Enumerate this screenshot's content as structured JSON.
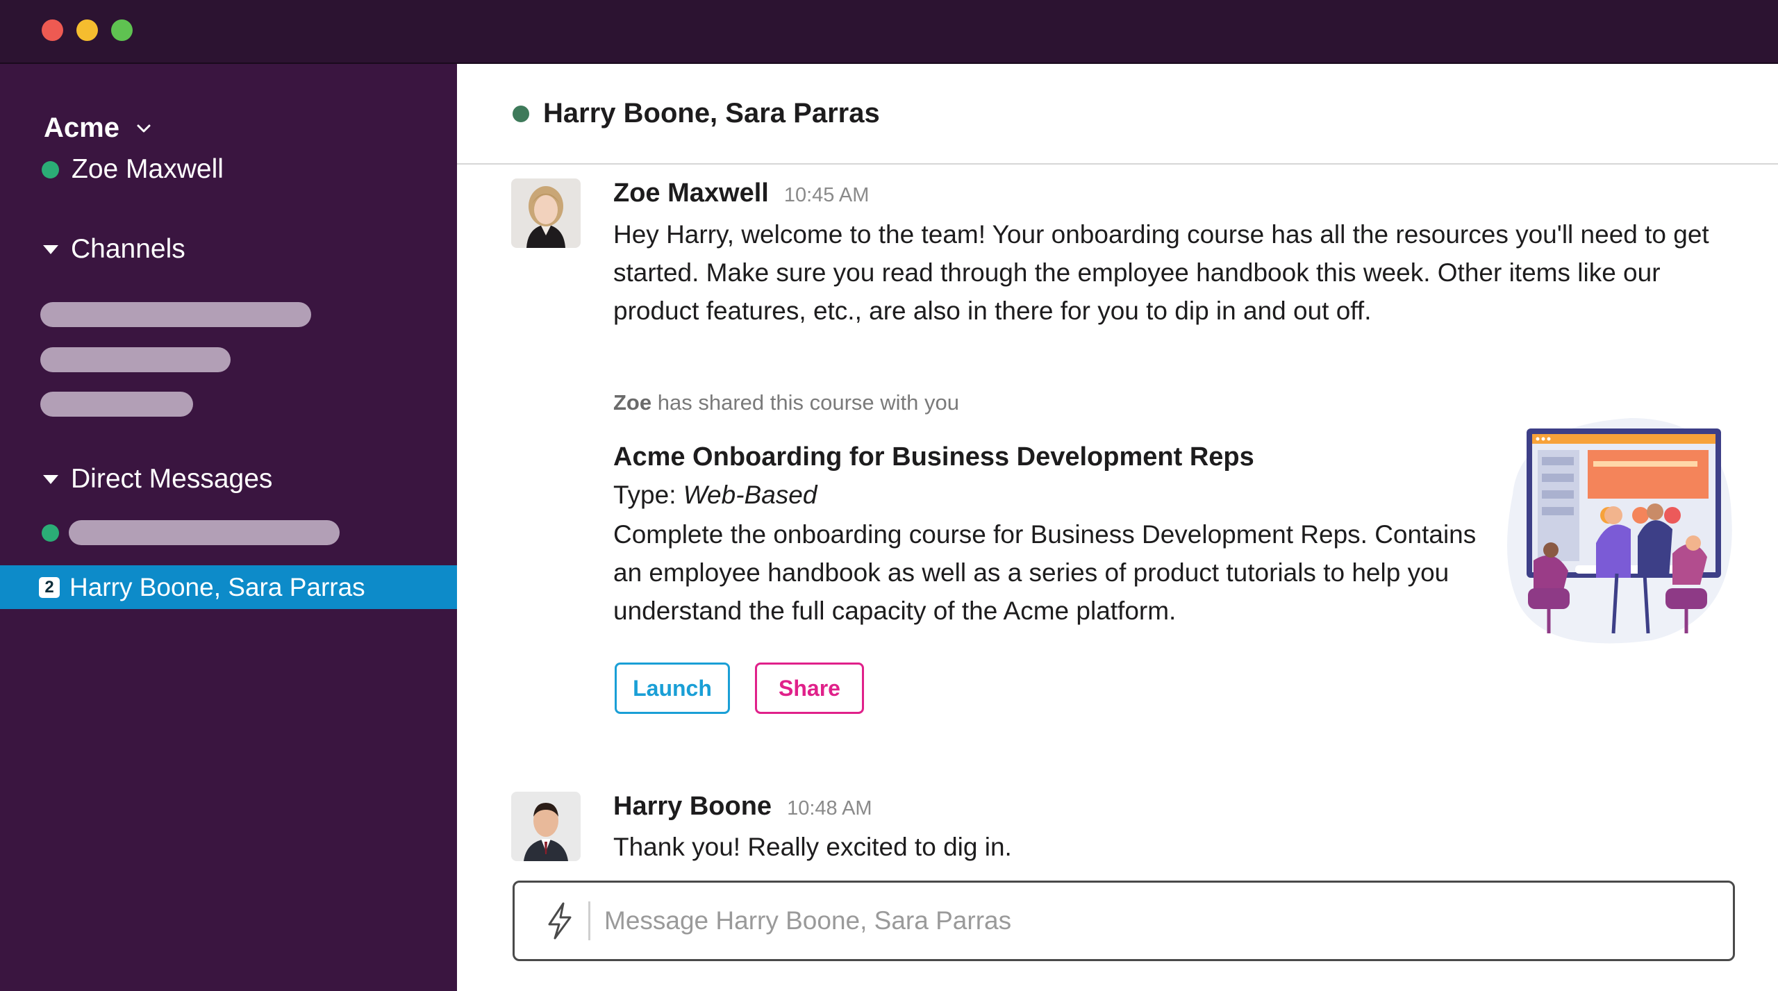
{
  "window": {
    "controls": [
      "close",
      "minimize",
      "zoom"
    ]
  },
  "sidebar": {
    "workspace": "Acme",
    "current_user": "Zoe Maxwell",
    "channels_label": "Channels",
    "dms_label": "Direct Messages",
    "active_conversation": {
      "badge": "2",
      "label": "Harry Boone, Sara Parras"
    }
  },
  "conversation": {
    "title": "Harry Boone, Sara Parras"
  },
  "messages": [
    {
      "author": "Zoe Maxwell",
      "time": "10:45 AM",
      "text": "Hey Harry, welcome to the team! Your onboarding course has all the resources you'll need to get started. Make sure you read through the employee handbook this week. Other items like our product features, etc., are also in there for you to dip in and out off."
    },
    {
      "author": "Harry Boone",
      "time": "10:48 AM",
      "text": "Thank you! Really excited to dig in."
    }
  ],
  "shared_course": {
    "sharer": "Zoe",
    "note": " has shared this course with you",
    "title": "Acme Onboarding for Business Development Reps",
    "type_label": "Type: ",
    "type_value": "Web-Based",
    "description": "Complete the onboarding course for Business Development Reps. Contains an employee handbook as well as a series of product tutorials to help you understand the full capacity of the Acme platform.",
    "launch_label": "Launch",
    "share_label": "Share"
  },
  "composer": {
    "placeholder": "Message Harry Boone, Sara Parras"
  },
  "colors": {
    "sidebar": "#3a1540",
    "titlebar": "#2c1331",
    "active_row": "#0d8bc9",
    "online": "#2bac76",
    "launch": "#1a9fd6",
    "share": "#e0218a"
  },
  "icons": [
    "chevron-down-icon",
    "caret-down-icon",
    "lightning-bolt-icon"
  ]
}
